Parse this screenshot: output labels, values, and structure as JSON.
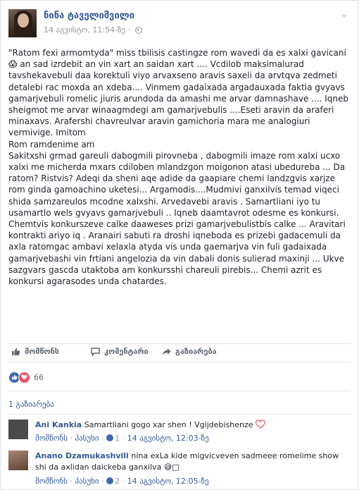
{
  "post": {
    "author": "ნინა ტაველიშვილი",
    "timestamp": "14 აგვისტო, 11:54-ზე",
    "body": "\"Ratom fexi armomtyda\" miss tbilisis castingze rom wavedi da es xalxi gavicani 😱 an sad izrdebit an vin xart an saidan xart .... Vcdilob maksimalurad tavshekavebuli daa korektuli viyo arvaxseno aravis saxeli da arvtqva zedmeti detalebi rac moxda an xdeba.... Vinmem gadaixada argadauxada faktia gvyavs gamarjvebuli romelic jiuris arundoda da amashi me arvar damnashave .... Iqneb sheigmot me arvar winaagmdegi am gamarjvebulis ....Eseti aravin da araferi minaxavs. Arafershi chavreulvar aravin gamichoria mara me analogiuri vermivige. Imitom\nRom ramdenime am\nSakitxshi grmad gareuli dabogmili pirovneba , dabogmili imaze rom xalxi ucxo xalxi me micherda mxars cdiloben mlandzgon moigonon atasi ubedureba ... Da ratom? Ristvis? Adeqi da sheni aqe adide da gaapiare chemi landzgvis xarjze rom ginda gamoachino uketesi... Argamodis....Mudmivi ganxilvis temad viqeci shida samzareulos mcodne xalxshi. Arvedavebi aravis . Samartliani iyo tu usamartlo wels gvyavs gamarjvebuli .. Iqneb daamtavrot odesme es konkursi. Chemtvis konkurszeve calke daaweses prizi gamarjvebulistbis calke ... Aravitari kontrakti ariyo iq . Aranairi sabuti ra droshi iqneboda es prizebi gadacemuli da axla ratomgac ambavi xelaxla atyda vis unda gaemarjva vin fuli gadaixada gamarjvebashi vin frtiani angelozia da vin dabali donis sulierad maxinji ... Ukve sazgvars gascda utaktoba am konkursshi chareuli pirebis... Chemi azrit es konkursi agarasodes unda chatardes."
  },
  "actions": {
    "like": "მომწონს",
    "comment": "კომენტარი",
    "share": "გაზიარება"
  },
  "reactions": {
    "count": "66"
  },
  "shares": {
    "label": "1 გაზიარება"
  },
  "comments": [
    {
      "name": "Ani Kankia",
      "text": "Samartliani gogo xar shen ! Vgijdebishenze",
      "like": "მომწონს",
      "reply": "პასუხი",
      "time": "14 აგვისტო, 12:03-ზე",
      "likes": "1",
      "avatar_color": "#4a4a4a"
    },
    {
      "name": "Anano Dzamukashvili",
      "text": "nina exLa kide migvicveven sadmeee romelime show shi da axlidan daickeba ganxilva 😅□",
      "like": "მომწონს",
      "reply": "პასუხი",
      "time": "14 აგვისტო, 12:05-ზე",
      "likes": "2",
      "avatar_color": "#8a6a56"
    }
  ],
  "colors": {
    "link": "#365899",
    "meta": "#90949c",
    "like_blue": "#4267b2",
    "love_red": "#f25268"
  }
}
